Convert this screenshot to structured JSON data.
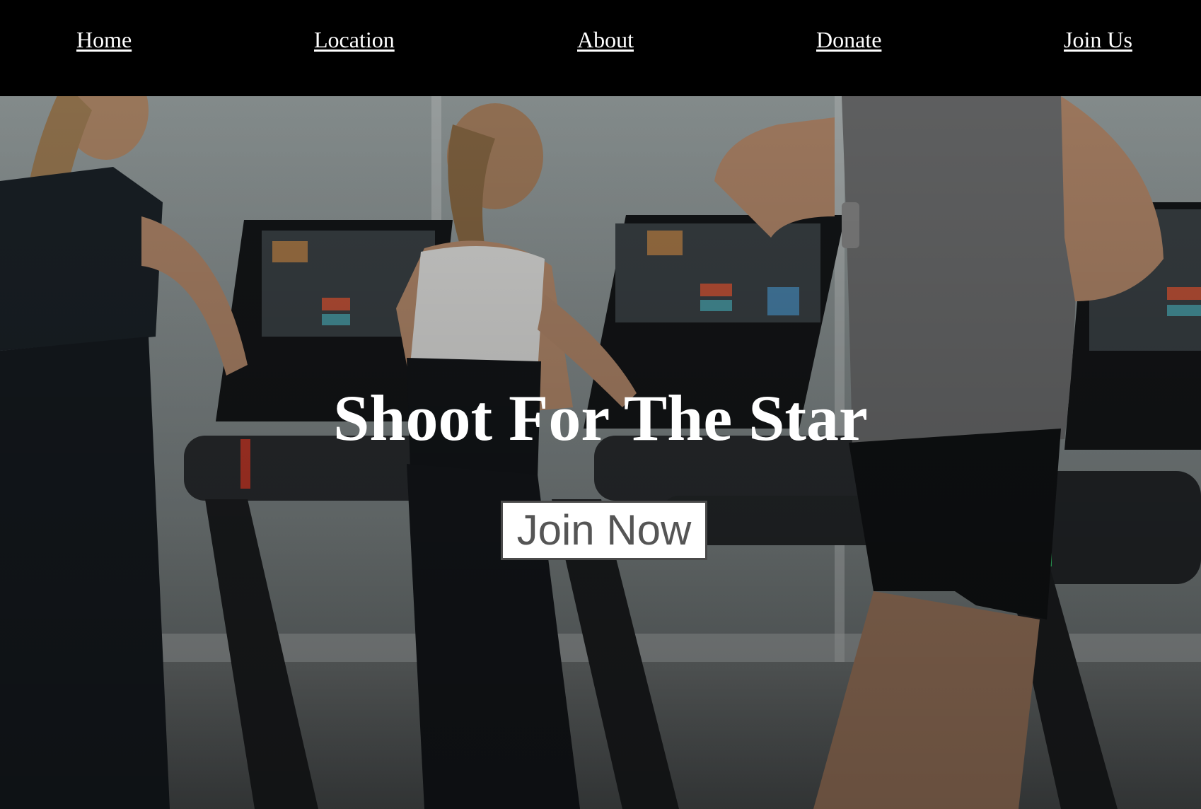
{
  "nav": {
    "items": [
      {
        "label": "Home"
      },
      {
        "label": "Location"
      },
      {
        "label": "About"
      },
      {
        "label": "Donate"
      },
      {
        "label": "Join Us"
      }
    ]
  },
  "hero": {
    "title": "Shoot For The Star",
    "cta_label": "Join Now",
    "background_image": "gym-treadmill-runners-photo"
  },
  "colors": {
    "nav_background": "#000000",
    "nav_text": "#ffffff",
    "hero_title": "#ffffff",
    "button_background": "#ffffff",
    "button_text": "#555555"
  }
}
